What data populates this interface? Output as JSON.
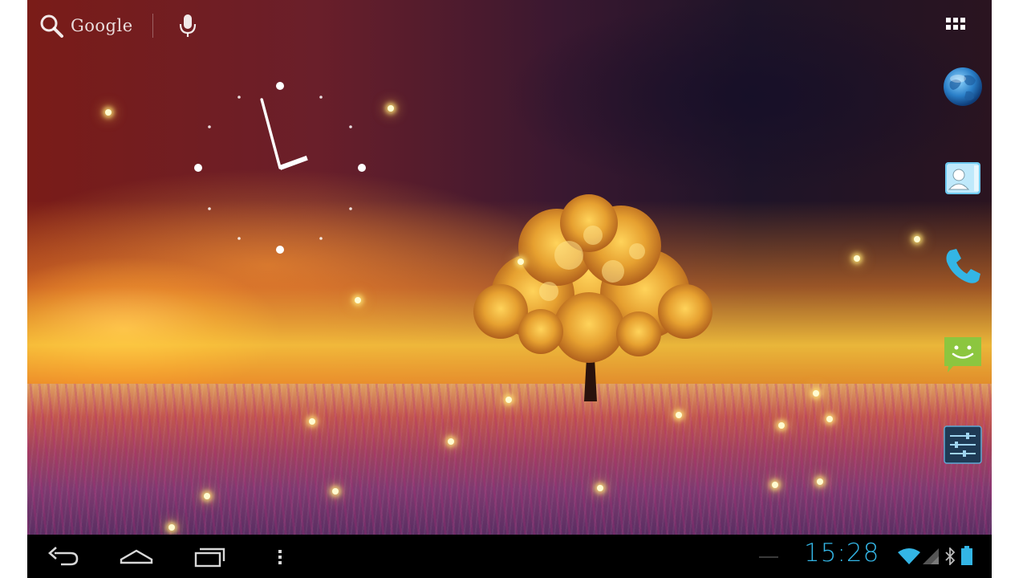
{
  "search": {
    "label": "Google",
    "search_icon": "search-icon",
    "mic_icon": "mic-icon"
  },
  "apps_button": {
    "icon": "apps-grid-icon"
  },
  "clock_widget": {
    "type": "analog",
    "hour_hand_angle_deg": 70,
    "minute_hand_angle_deg": 345
  },
  "dock": {
    "items": [
      {
        "name": "browser",
        "icon": "globe-icon"
      },
      {
        "name": "contacts",
        "icon": "contact-card-icon"
      },
      {
        "name": "phone",
        "icon": "phone-icon"
      },
      {
        "name": "messaging",
        "icon": "smiley-chat-icon"
      },
      {
        "name": "settings",
        "icon": "sliders-icon"
      }
    ]
  },
  "navbar": {
    "buttons": [
      {
        "name": "back",
        "icon": "back-icon"
      },
      {
        "name": "home",
        "icon": "home-icon"
      },
      {
        "name": "recent-apps",
        "icon": "recent-apps-icon"
      },
      {
        "name": "menu",
        "icon": "overflow-menu-icon"
      }
    ],
    "status": {
      "time": "15:28",
      "icons": [
        "wifi-icon",
        "signal-icon",
        "bluetooth-icon",
        "battery-icon"
      ]
    }
  },
  "colors": {
    "status_accent": "#33b5e5",
    "navbar_bg": "#000000"
  }
}
